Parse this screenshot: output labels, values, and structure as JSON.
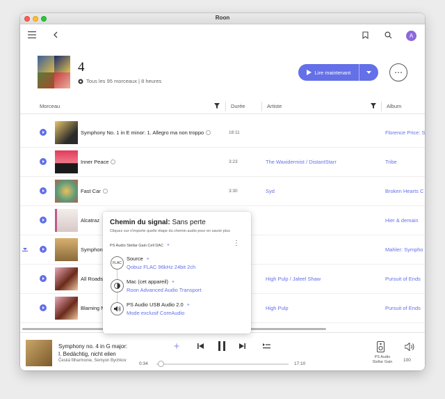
{
  "window": {
    "title": "Roon"
  },
  "playlist": {
    "title": "4",
    "subtitle": "Tous les 95 morceaux | 8 heures",
    "play_label": "Lire maintenant"
  },
  "columns": {
    "track": "Morceau",
    "duration": "Durée",
    "artist": "Artiste",
    "album": "Album"
  },
  "tracks": [
    {
      "title": "Symphony No. 1 in E minor: 1. Allegro ma non troppo",
      "duration": "18:11",
      "artist": "",
      "album": "Florence Price: S"
    },
    {
      "title": "Inner Peace",
      "duration": "3:23",
      "artist": "The Waxidermist / DistantStarr",
      "album": "Tribe"
    },
    {
      "title": "Fast Car",
      "duration": "3:30",
      "artist": "Syd",
      "album": "Broken Hearts C"
    },
    {
      "title": "Alcatraz",
      "duration": "",
      "artist": "",
      "album": "Hier & demain"
    },
    {
      "title": "Symphon",
      "duration": "",
      "artist": "",
      "album": "Mahler: Sympho"
    },
    {
      "title": "All Roads",
      "duration": "",
      "artist": "High Pulp / Jaleel Shaw",
      "album": "Pursuit of Ends"
    },
    {
      "title": "Blaming N",
      "duration": "",
      "artist": "High Pulp",
      "album": "Pursuit of Ends"
    }
  ],
  "signal_path": {
    "title": "Chemin du signal:",
    "quality": "Sans perte",
    "hint": "Cliquez sur n'importe quelle étape du chemin audio pour en savoir plus",
    "device": "PS Audio Stellar Gain Cell DAC",
    "steps": [
      {
        "node": "FLAC",
        "title": "Source",
        "detail": "Qobuz FLAC 96kHz 24bit 2ch"
      },
      {
        "node": "",
        "title": "Mac (cet appareil)",
        "detail": "Roon Advanced Audio Transport"
      },
      {
        "node": "",
        "title": "PS Audio USB Audio 2.0",
        "detail": "Mode exclusif CoreAudio"
      }
    ]
  },
  "now_playing": {
    "title_line1": "Symphony no. 4 in G major:",
    "title_line2": "I. Bedächtig, nicht eilen",
    "artist": "Česká filharmonie, Semyon Bychkov",
    "elapsed": "0:34",
    "total": "17:10",
    "progress": 0.033,
    "zone_line1": "PS Audio",
    "zone_line2": "Stellar Gain",
    "volume": "100"
  },
  "colors": {
    "accent": "#6470e8",
    "avatar": "#8e68dc"
  },
  "icons": [
    "hamburger-icon",
    "back-icon",
    "bookmark-icon",
    "search-icon",
    "filter-icon",
    "play-icon",
    "skip-prev-icon",
    "pause-icon",
    "skip-next-icon",
    "queue-icon",
    "speaker-icon",
    "volume-icon"
  ]
}
